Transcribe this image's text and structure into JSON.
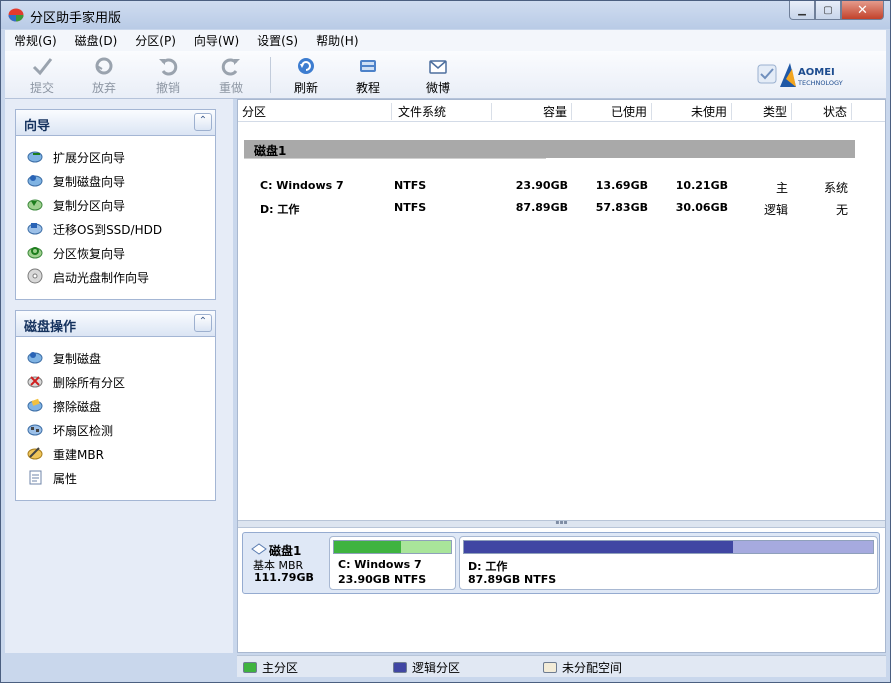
{
  "window": {
    "title": "分区助手家用版"
  },
  "menu": [
    "常规(G)",
    "磁盘(D)",
    "分区(P)",
    "向导(W)",
    "设置(S)",
    "帮助(H)"
  ],
  "toolbar": {
    "apply": "提交",
    "discard": "放弃",
    "undo": "撤销",
    "redo": "重做",
    "refresh": "刷新",
    "tutorial": "教程",
    "weibo": "微博"
  },
  "brand": {
    "name": "AOMEI",
    "sub": "TECHNOLOGY"
  },
  "wizards": {
    "title": "向导",
    "items": [
      "扩展分区向导",
      "复制磁盘向导",
      "复制分区向导",
      "迁移OS到SSD/HDD",
      "分区恢复向导",
      "启动光盘制作向导"
    ]
  },
  "disk_ops": {
    "title": "磁盘操作",
    "items": [
      "复制磁盘",
      "删除所有分区",
      "擦除磁盘",
      "坏扇区检测",
      "重建MBR",
      "属性"
    ]
  },
  "table": {
    "headers": [
      "分区",
      "文件系统",
      "容量",
      "已使用",
      "未使用",
      "类型",
      "状态"
    ],
    "disk_label": "磁盘1",
    "rows": [
      {
        "partition": "C: Windows 7",
        "fs": "NTFS",
        "capacity": "23.90GB",
        "used": "13.69GB",
        "free": "10.21GB",
        "type": "主",
        "status": "系统"
      },
      {
        "partition": "D: 工作",
        "fs": "NTFS",
        "capacity": "87.89GB",
        "used": "57.83GB",
        "free": "30.06GB",
        "type": "逻辑",
        "status": "无"
      }
    ]
  },
  "disk_map": {
    "disk_name": "磁盘1",
    "disk_type": "基本 MBR",
    "disk_size": "111.79GB",
    "partitions": [
      {
        "name": "C: Windows 7",
        "size": "23.90GB NTFS",
        "used_fraction": 0.573,
        "color": "#3fb33f"
      },
      {
        "name": "D: 工作",
        "size": "87.89GB NTFS",
        "used_fraction": 0.658,
        "color": "#4046a3"
      }
    ]
  },
  "legend": {
    "primary": "主分区",
    "logical": "逻辑分区",
    "unallocated": "未分配空间"
  },
  "colors": {
    "primary": "#3fb33f",
    "logical": "#4046a3",
    "unallocated": "#f3ecd8"
  }
}
